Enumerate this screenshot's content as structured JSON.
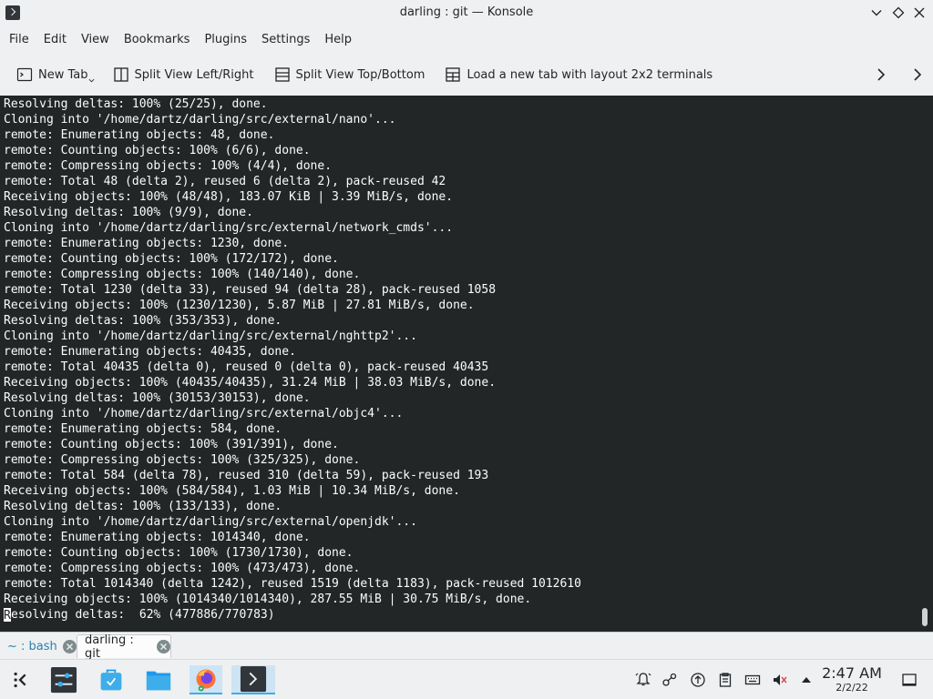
{
  "window": {
    "title": "darling : git — Konsole",
    "buttons": {
      "minimize": "minimize",
      "maximize": "maximize",
      "close": "close"
    }
  },
  "menu": [
    "File",
    "Edit",
    "View",
    "Bookmarks",
    "Plugins",
    "Settings",
    "Help"
  ],
  "toolbar": {
    "new_tab": "New Tab",
    "split_lr": "Split View Left/Right",
    "split_tb": "Split View Top/Bottom",
    "load_layout": "Load a new tab with layout 2x2 terminals"
  },
  "terminal": {
    "lines": [
      "Resolving deltas: 100% (25/25), done.",
      "Cloning into '/home/dartz/darling/src/external/nano'...",
      "remote: Enumerating objects: 48, done.",
      "remote: Counting objects: 100% (6/6), done.",
      "remote: Compressing objects: 100% (4/4), done.",
      "remote: Total 48 (delta 2), reused 6 (delta 2), pack-reused 42",
      "Receiving objects: 100% (48/48), 183.07 KiB | 3.39 MiB/s, done.",
      "Resolving deltas: 100% (9/9), done.",
      "Cloning into '/home/dartz/darling/src/external/network_cmds'...",
      "remote: Enumerating objects: 1230, done.",
      "remote: Counting objects: 100% (172/172), done.",
      "remote: Compressing objects: 100% (140/140), done.",
      "remote: Total 1230 (delta 33), reused 94 (delta 28), pack-reused 1058",
      "Receiving objects: 100% (1230/1230), 5.87 MiB | 27.81 MiB/s, done.",
      "Resolving deltas: 100% (353/353), done.",
      "Cloning into '/home/dartz/darling/src/external/nghttp2'...",
      "remote: Enumerating objects: 40435, done.",
      "remote: Total 40435 (delta 0), reused 0 (delta 0), pack-reused 40435",
      "Receiving objects: 100% (40435/40435), 31.24 MiB | 38.03 MiB/s, done.",
      "Resolving deltas: 100% (30153/30153), done.",
      "Cloning into '/home/dartz/darling/src/external/objc4'...",
      "remote: Enumerating objects: 584, done.",
      "remote: Counting objects: 100% (391/391), done.",
      "remote: Compressing objects: 100% (325/325), done.",
      "remote: Total 584 (delta 78), reused 310 (delta 59), pack-reused 193",
      "Receiving objects: 100% (584/584), 1.03 MiB | 10.34 MiB/s, done.",
      "Resolving deltas: 100% (133/133), done.",
      "Cloning into '/home/dartz/darling/src/external/openjdk'...",
      "remote: Enumerating objects: 1014340, done.",
      "remote: Counting objects: 100% (1730/1730), done.",
      "remote: Compressing objects: 100% (473/473), done.",
      "remote: Total 1014340 (delta 1242), reused 1519 (delta 1183), pack-reused 1012610",
      "Receiving objects: 100% (1014340/1014340), 287.55 MiB | 30.75 MiB/s, done."
    ],
    "last_line_first_char": "R",
    "last_line_rest": "esolving deltas:  62% (477886/770783)"
  },
  "tabs": [
    {
      "label": "~ : bash"
    },
    {
      "label": "darling : git"
    }
  ],
  "taskbar": {
    "icons": [
      "application-launcher-icon",
      "system-settings-icon",
      "discover-icon",
      "dolphin-folder-icon",
      "firefox-icon",
      "konsole-icon"
    ],
    "time": "2:47 AM",
    "date": "2/2/22"
  },
  "colors": {
    "terminal_bg": "#232627",
    "terminal_fg": "#fcfcfc",
    "accent": "#3daee9"
  }
}
